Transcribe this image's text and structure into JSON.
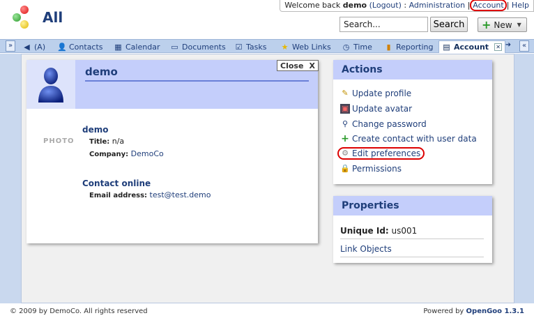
{
  "header": {
    "workspace_title": "All",
    "welcome_prefix": "Welcome back",
    "username": "demo",
    "logout_link": "(Logout)",
    "sep1": ":",
    "administration_link": "Administration",
    "account_link": "Account",
    "help_link": "Help",
    "search_value": "Search...",
    "search_button": "Search",
    "new_button": "New"
  },
  "tabs": [
    {
      "label": "(A)",
      "icon": "arrow-left-icon"
    },
    {
      "label": "Contacts",
      "icon": "contacts-icon"
    },
    {
      "label": "Calendar",
      "icon": "calendar-icon"
    },
    {
      "label": "Documents",
      "icon": "documents-icon"
    },
    {
      "label": "Tasks",
      "icon": "tasks-icon"
    },
    {
      "label": "Web Links",
      "icon": "star-icon"
    },
    {
      "label": "Time",
      "icon": "clock-icon"
    },
    {
      "label": "Reporting",
      "icon": "chart-icon"
    },
    {
      "label": "Account",
      "icon": "account-icon"
    }
  ],
  "card": {
    "name": "demo",
    "close_label": "Close",
    "close_x": "X",
    "photo_label": "PHOTO",
    "section_name": "demo",
    "title_label": "Title:",
    "title_value": "n/a",
    "company_label": "Company:",
    "company_value": "DemoCo",
    "online_title": "Contact online",
    "email_label": "Email address:",
    "email_value": "test@test.demo"
  },
  "actions": {
    "title": "Actions",
    "items": [
      {
        "label": "Update profile",
        "icon": "pencil-icon"
      },
      {
        "label": "Update avatar",
        "icon": "image-icon"
      },
      {
        "label": "Change password",
        "icon": "key-icon"
      },
      {
        "label": "Create contact with user data",
        "icon": "plus-icon"
      },
      {
        "label": "Edit preferences",
        "icon": "gear-icon"
      },
      {
        "label": "Permissions",
        "icon": "lock-user-icon"
      }
    ]
  },
  "properties": {
    "title": "Properties",
    "unique_id_label": "Unique Id:",
    "unique_id_value": "us001",
    "link_objects": "Link Objects"
  },
  "footer": {
    "copyright": "© 2009 by DemoCo. All rights reserved",
    "powered_by": "Powered by",
    "product": "OpenGoo 1.3.1"
  },
  "colors": {
    "accent": "#1f3e7a",
    "panel_header": "#c4cefb",
    "highlight": "#dd0000"
  }
}
